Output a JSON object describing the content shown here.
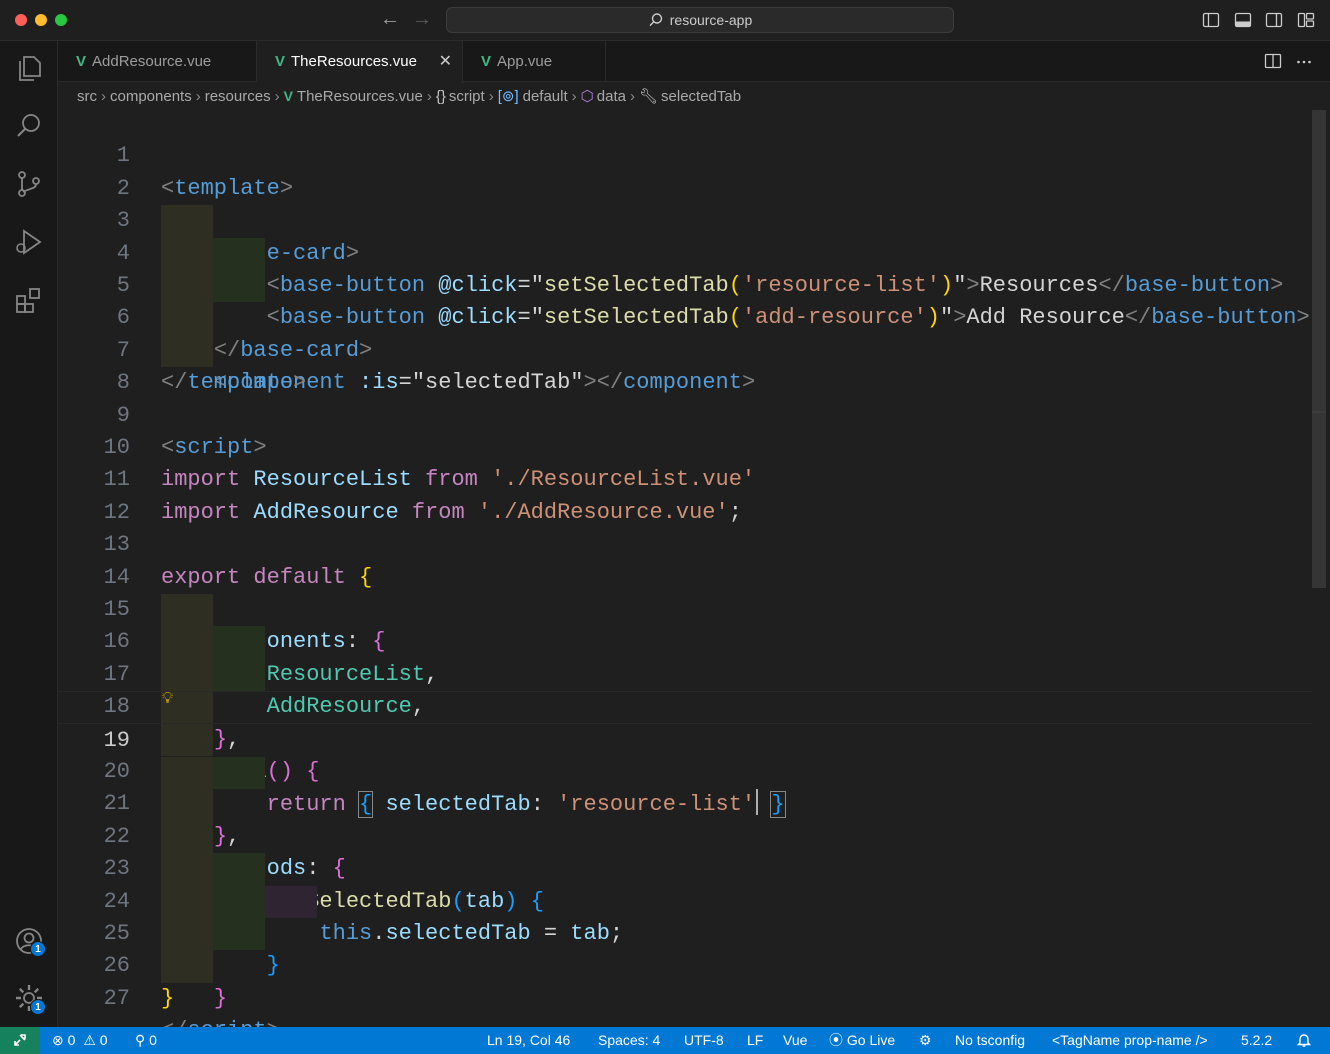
{
  "window": {
    "search_text": "resource-app"
  },
  "activity": {
    "accounts_badge": "1",
    "manage_badge": "1"
  },
  "tabs": [
    {
      "label": "AddResource.vue",
      "icon": "vue-icon"
    },
    {
      "label": "TheResources.vue",
      "icon": "vue-icon",
      "active": true
    },
    {
      "label": "App.vue",
      "icon": "vue-icon"
    }
  ],
  "vue_glyph": "V",
  "breadcrumb": [
    "src",
    "components",
    "resources",
    "TheResources.vue",
    "script",
    "default",
    "data",
    "selectedTab"
  ],
  "editor": {
    "line_numbers": [
      "1",
      "2",
      "3",
      "4",
      "5",
      "6",
      "7",
      "8",
      "9",
      "10",
      "11",
      "12",
      "13",
      "14",
      "15",
      "16",
      "17",
      "18",
      "19",
      "20",
      "21",
      "22",
      "23",
      "24",
      "25",
      "26",
      "27"
    ],
    "current_line": "19"
  },
  "colors": {
    "accent": "#0078d4",
    "remote": "#16825d",
    "vue": "#41b883"
  },
  "status": {
    "errors": "0",
    "warnings": "0",
    "ports": "0",
    "position": "Ln 19, Col 46",
    "spaces": "Spaces: 4",
    "encoding": "UTF-8",
    "eol": "LF",
    "language": "Vue",
    "go_live": "Go Live",
    "tsconfig": "No tsconfig",
    "tag_hint": "<TagName prop-name />",
    "version": "5.2.2"
  }
}
